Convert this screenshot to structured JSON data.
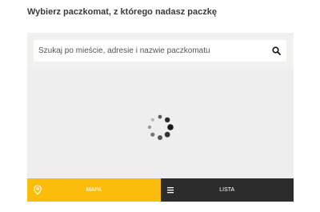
{
  "page": {
    "heading": "Wybierz paczkomat, z którego nadasz paczkę"
  },
  "search": {
    "placeholder": "Szukaj po mieście, adresie i nazwie paczkomatu",
    "value": "",
    "icon": "search-icon"
  },
  "map": {
    "status": "loading",
    "spinner_icon": "loading-spinner-icon"
  },
  "view_toggle": {
    "map_label": "MAPA",
    "map_icon": "map-pin-icon",
    "list_label": "LISTA",
    "list_icon": "list-icon",
    "active": "map"
  },
  "colors": {
    "accent": "#fbbd0b",
    "dark": "#2c2c2c",
    "panel_bg": "#eeeeee",
    "text": "#3a3a3a"
  }
}
